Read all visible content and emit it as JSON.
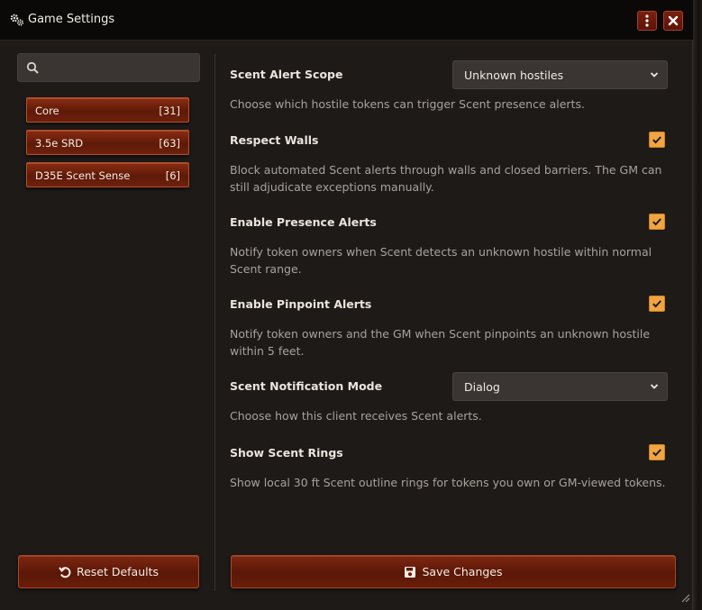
{
  "window": {
    "title": "Game Settings",
    "menu_icon": "kebab-icon",
    "close_icon": "close-icon"
  },
  "sidebar": {
    "search": {
      "placeholder": "",
      "value": ""
    },
    "categories": [
      {
        "label": "Core",
        "count": "[31]"
      },
      {
        "label": "3.5e SRD",
        "count": "[63]"
      },
      {
        "label": "D35E Scent Sense",
        "count": "[6]"
      }
    ]
  },
  "settings": [
    {
      "label": "Scent Alert Scope",
      "control": "select",
      "value": "Unknown hostiles",
      "hint": "Choose which hostile tokens can trigger Scent presence alerts."
    },
    {
      "label": "Respect Walls",
      "control": "checkbox",
      "checked": true,
      "hint": "Block automated Scent alerts through walls and closed barriers. The GM can still adjudicate exceptions manually."
    },
    {
      "label": "Enable Presence Alerts",
      "control": "checkbox",
      "checked": true,
      "hint": "Notify token owners when Scent detects an unknown hostile within normal Scent range."
    },
    {
      "label": "Enable Pinpoint Alerts",
      "control": "checkbox",
      "checked": true,
      "hint": "Notify token owners and the GM when Scent pinpoints an unknown hostile within 5 feet."
    },
    {
      "label": "Scent Notification Mode",
      "control": "select",
      "value": "Dialog",
      "hint": "Choose how this client receives Scent alerts."
    },
    {
      "label": "Show Scent Rings",
      "control": "checkbox",
      "checked": true,
      "hint": "Show local 30 ft Scent outline rings for tokens you own or GM-viewed tokens."
    }
  ],
  "footer": {
    "reset_label": "Reset Defaults",
    "save_label": "Save Changes"
  },
  "colors": {
    "accent_checkbox": "#f0a541",
    "button_brown": "#6e200c",
    "background": "#1d1a18"
  }
}
